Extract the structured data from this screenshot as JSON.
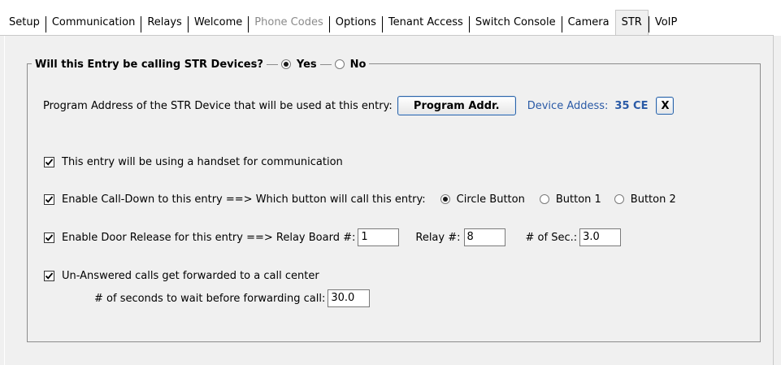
{
  "tabs": [
    {
      "label": "Setup",
      "state": "normal"
    },
    {
      "label": "Communication",
      "state": "normal"
    },
    {
      "label": "Relays",
      "state": "normal"
    },
    {
      "label": "Welcome",
      "state": "normal"
    },
    {
      "label": "Phone Codes",
      "state": "disabled"
    },
    {
      "label": "Options",
      "state": "normal"
    },
    {
      "label": "Tenant Access",
      "state": "normal"
    },
    {
      "label": "Switch Console",
      "state": "normal"
    },
    {
      "label": "Camera",
      "state": "normal"
    },
    {
      "label": "STR",
      "state": "active"
    },
    {
      "label": "VoIP",
      "state": "normal"
    }
  ],
  "group": {
    "question": "Will this Entry be calling STR Devices?",
    "yes_label": "Yes",
    "no_label": "No",
    "selected": "yes"
  },
  "program": {
    "label": "Program Address of the STR Device that will be used at this entry:",
    "button_label": "Program Addr.",
    "device_address_label": "Device Addess:",
    "device_address_value": "35 CE",
    "clear_button_label": "X"
  },
  "handset": {
    "label": "This entry will be using a handset for communication",
    "checked": true
  },
  "calldown": {
    "label": "Enable Call-Down to this entry  ==> Which button will call this entry:",
    "checked": true,
    "options": [
      "Circle Button",
      "Button 1",
      "Button 2"
    ],
    "selected_index": 0
  },
  "door_release": {
    "label": "Enable Door Release for this entry  ==> Relay Board #:",
    "checked": true,
    "relay_board_value": "1",
    "relay_label": "Relay #:",
    "relay_value": "8",
    "seconds_label": "# of Sec.:",
    "seconds_value": "3.0"
  },
  "forwarding": {
    "label": "Un-Answered calls get forwarded to a call center",
    "checked": true,
    "wait_label": "# of seconds to wait before forwarding call:",
    "wait_value": "30.0"
  }
}
